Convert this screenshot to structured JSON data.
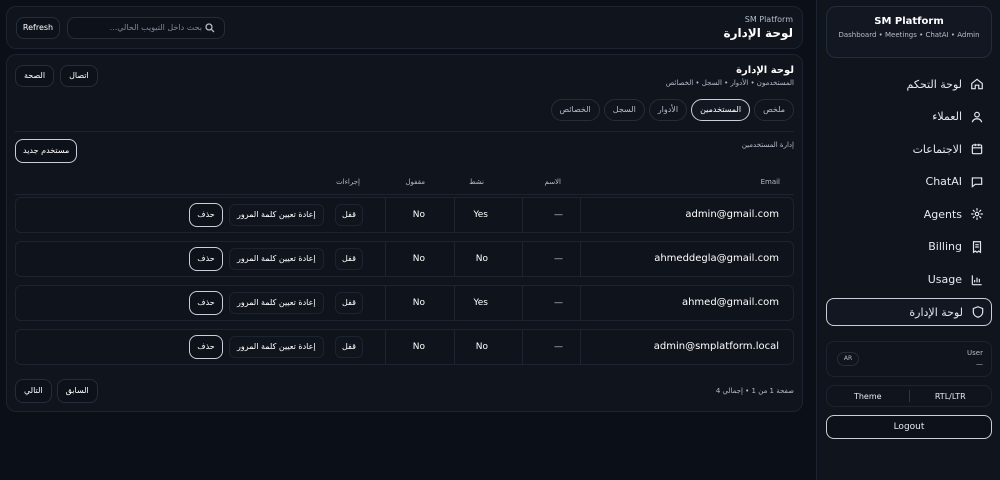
{
  "sidebar": {
    "brand_title": "SM Platform",
    "brand_sub": "Dashboard • Meetings • ChatAI • Admin",
    "items": [
      {
        "label": "لوحة التحكم",
        "icon": "home-icon"
      },
      {
        "label": "العملاء",
        "icon": "user-icon"
      },
      {
        "label": "الاجتماعات",
        "icon": "calendar-icon"
      },
      {
        "label": "ChatAI",
        "icon": "chat-icon"
      },
      {
        "label": "Agents",
        "icon": "gear-icon"
      },
      {
        "label": "Billing",
        "icon": "billing-icon"
      },
      {
        "label": "Usage",
        "icon": "chart-icon"
      },
      {
        "label": "لوحة الإدارة",
        "icon": "shield-icon",
        "active": true
      }
    ],
    "user_label": "User",
    "user_value": "—",
    "lang_badge": "AR",
    "theme_label": "Theme",
    "direction_label": "RTL/LTR",
    "logout_label": "Logout"
  },
  "topbar": {
    "kicker": "SM Platform",
    "title": "لوحة الإدارة",
    "search_placeholder": "بحث داخل التبويب الحالي...",
    "refresh_label": "Refresh"
  },
  "admin": {
    "title": "لوحة الإدارة",
    "crumb": "المستخدمون • الأدوار • السجل • الخصائص",
    "btn_connect": "اتصال",
    "btn_health": "الصحة",
    "tabs": [
      "ملخص",
      "المستخدمين",
      "الأدوار",
      "السجل",
      "الخصائص"
    ],
    "active_tab": 1,
    "section_title": "إدارة المستخدمين",
    "new_user_label": "مستخدم جديد",
    "columns": {
      "email": "Email",
      "name": "الاسم",
      "active": "نشط",
      "locked": "مقفول",
      "actions": "إجراءات"
    },
    "rows": [
      {
        "email": "admin@gmail.com",
        "name": "—",
        "active": "Yes",
        "locked": "No"
      },
      {
        "email": "ahmeddegla@gmail.com",
        "name": "—",
        "active": "No",
        "locked": "No"
      },
      {
        "email": "ahmed@gmail.com",
        "name": "—",
        "active": "Yes",
        "locked": "No"
      },
      {
        "email": "admin@smplatform.local",
        "name": "—",
        "active": "No",
        "locked": "No"
      }
    ],
    "action_lock": "قفل",
    "action_reset": "إعادة تعيين كلمة المرور",
    "action_delete": "حذف",
    "page_info": "صفحة 1 من 1 • إجمالي 4",
    "prev_label": "السابق",
    "next_label": "التالي"
  },
  "colors": {
    "background": "#0b0f17",
    "panel": "#10141d",
    "border": "#1d2330",
    "accent_border": "#c9ced8"
  }
}
